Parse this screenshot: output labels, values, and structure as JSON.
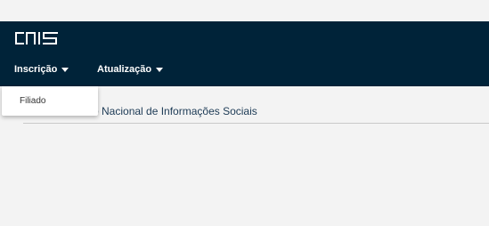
{
  "brand": {
    "logo_text": "CNIS",
    "color": "#002339"
  },
  "menu": {
    "items": [
      {
        "label": "Inscrição",
        "expanded": true
      },
      {
        "label": "Atualização",
        "expanded": false
      }
    ]
  },
  "dropdown": {
    "items": [
      {
        "label": "Filiado"
      }
    ]
  },
  "main": {
    "title": "o Nacional de Informações Sociais"
  }
}
